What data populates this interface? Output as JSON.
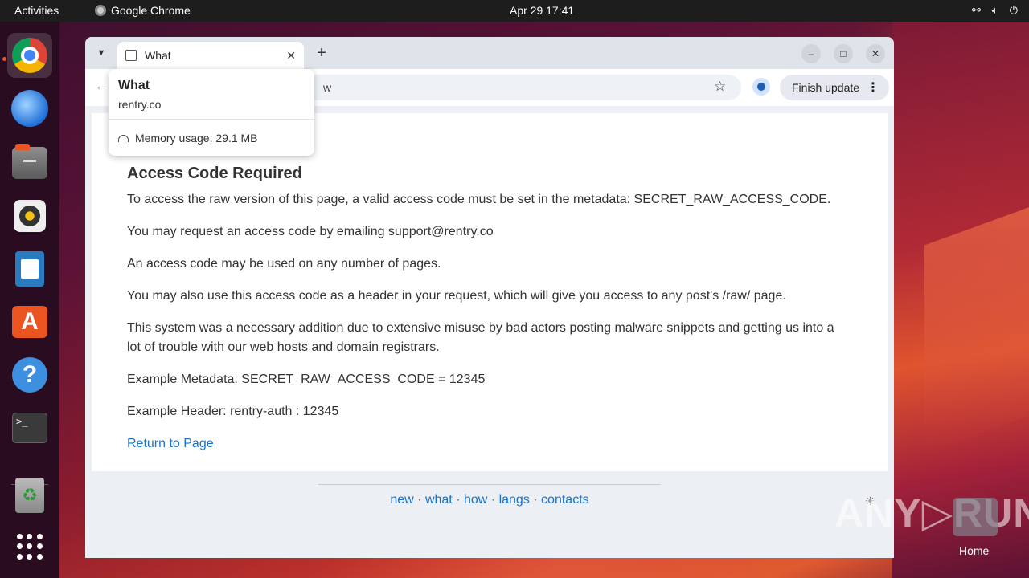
{
  "topbar": {
    "activities": "Activities",
    "app_name": "Google Chrome",
    "clock": "Apr 29  17:41",
    "tray": [
      "network-icon",
      "volume-icon",
      "power-icon"
    ]
  },
  "dock": {
    "items": [
      "chrome-icon",
      "thunderbird-icon",
      "files-icon",
      "rhythmbox-icon",
      "libreoffice-writer-icon",
      "app-center-icon",
      "help-icon",
      "terminal-icon",
      "trash-icon",
      "show-apps-icon"
    ]
  },
  "browser": {
    "tab_title": "What",
    "omnibox_fragment": "w",
    "finish_update_label": "Finish update"
  },
  "hovercard": {
    "title": "What",
    "url": "rentry.co",
    "memory": "Memory usage: 29.1 MB"
  },
  "page": {
    "heading": "Access Code Required",
    "paragraphs": [
      "To access the raw version of this page, a valid access code must be set in the metadata: SECRET_RAW_ACCESS_CODE.",
      "You may request an access code by emailing support@rentry.co",
      "An access code may be used on any number of pages.",
      "You may also use this access code as a header in your request, which will give you access to any post's /raw/ page.",
      "This system was a necessary addition due to extensive misuse by bad actors posting malware snippets and getting us into a lot of trouble with our web hosts and domain registrars.",
      "Example Metadata: SECRET_RAW_ACCESS_CODE = 12345",
      "Example Header: rentry-auth : 12345"
    ],
    "return_link": "Return to Page",
    "footer_links": [
      "new",
      "what",
      "how",
      "langs",
      "contacts"
    ],
    "footer_sep": "·"
  },
  "overlay": {
    "watermark": "ANY▷RUN",
    "home_label": "Home"
  },
  "colors": {
    "link": "#1a73c8",
    "accent": "#e95420"
  }
}
